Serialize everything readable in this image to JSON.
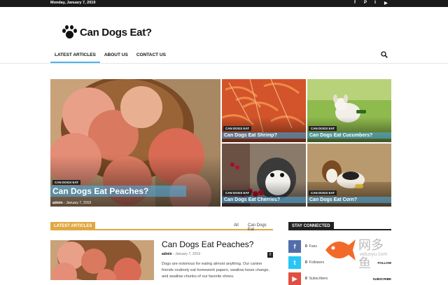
{
  "topbar": {
    "date": "Monday, January 7, 2019",
    "social": [
      "f",
      "P",
      "t",
      "▶"
    ]
  },
  "site": {
    "title": "Can Dogs Eat?"
  },
  "nav": {
    "items": [
      {
        "label": "LATEST ARTICLES",
        "active": true
      },
      {
        "label": "ABOUT US",
        "active": false
      },
      {
        "label": "CONTACT US",
        "active": false
      }
    ],
    "search_icon": "search-icon"
  },
  "featured": {
    "main": {
      "category": "CAN DOGS EAT",
      "title": "Can Dogs Eat Peaches?",
      "author": "admin",
      "date": "January 7, 2019"
    },
    "tiles": [
      {
        "category": "CAN DOGS EAT",
        "title": "Can Dogs Eat Shrimp?"
      },
      {
        "category": "CAN DOGS EAT",
        "title": "Can Dogs Eat Cucumbers?"
      },
      {
        "category": "CAN DOGS EAT",
        "title": "Can Dogs Eat Cherries?"
      },
      {
        "category": "CAN DOGS EAT",
        "title": "Can Dogs Eat Corn?"
      }
    ]
  },
  "latest": {
    "label": "LATEST ARTICLES",
    "filter_all": "All",
    "filter_cat": "Can Dogs Eat",
    "article": {
      "title": "Can Dogs Eat Peaches?",
      "author": "admin",
      "date": "January 7, 2019",
      "comments": "0",
      "excerpt": "Dogs are notorious for eating almost anything. Our canine friends routinely eat homework papers, swallow loose change, and swallow chunks of our favorite shoes."
    }
  },
  "stay": {
    "label": "STAY CONNECTED",
    "rows": [
      {
        "icon": "f",
        "count": "0",
        "label": "Fans",
        "action": "",
        "color": "#516eab"
      },
      {
        "icon": "t",
        "count": "0",
        "label": "Followers",
        "action": "FOLLOW",
        "color": "#29c5f6"
      },
      {
        "icon": "▶",
        "count": "0",
        "label": "Subscribers",
        "action": "SUBSCRIBE",
        "color": "#e14e42"
      }
    ]
  },
  "watermark": {
    "cn": "网多鱼",
    "url": "wduoyu.com"
  }
}
